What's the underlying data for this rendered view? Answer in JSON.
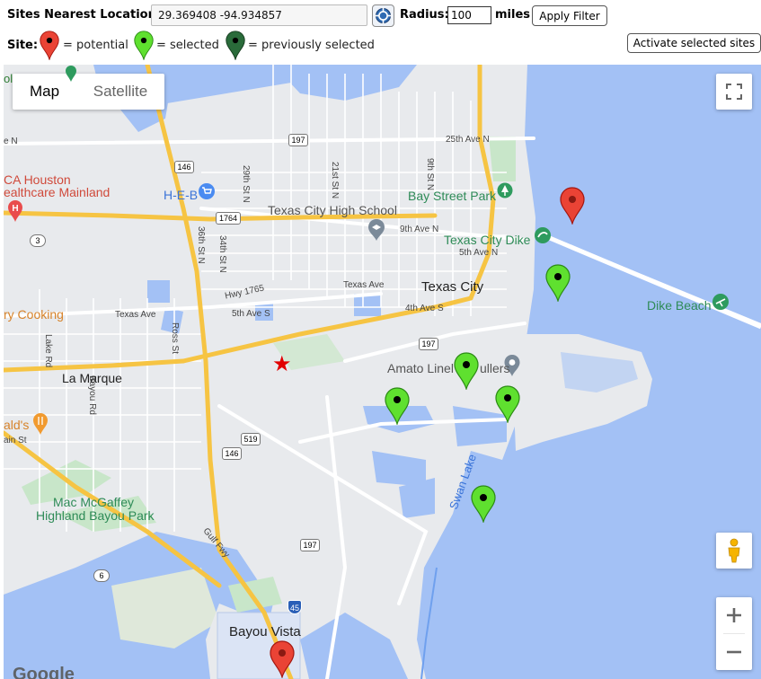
{
  "filter": {
    "location_label": "Sites Nearest Location:",
    "location_value": "29.369408 -94.934857",
    "radius_label": "Radius:",
    "radius_value": "100",
    "miles_label": "miles",
    "apply_label": "Apply Filter"
  },
  "legend": {
    "site_label": "Site:",
    "potential": "= potential",
    "selected": "= selected",
    "previously_selected": "= previously selected"
  },
  "activate_label": "Activate selected sites",
  "colors": {
    "potential": "#ea4335",
    "selected": "#5fe02f",
    "previously_selected": "#2a6b3a",
    "water": "#a3c1f5"
  },
  "map": {
    "type_map": "Map",
    "type_satellite": "Satellite",
    "labels": {
      "ol": "ol",
      "ave_n_left": "e N",
      "chca_1": "CA Houston",
      "chca_2": "ealthcare Mainland",
      "heb": "H-E-B",
      "tc_high": "Texas City High School",
      "bay_street": "Bay Street Park",
      "tc_dike": "Texas City Dike",
      "dike_beach": "Dike Beach",
      "ave_25": "25th Ave N",
      "ave_9": "9th Ave N",
      "ave_5n": "5th Ave N",
      "texas_city": "Texas City",
      "texas_ave": "Texas Ave",
      "ave_4s": "4th Ave S",
      "hwy_1765": "Hwy 1765",
      "ave_5s": "5th Ave S",
      "texas_ave_w": "Texas Ave",
      "st_29": "29th St N",
      "st_21": "21st St N",
      "st_9": "9th St N",
      "st_36": "36th St N",
      "st_34": "34th St N",
      "lake_rd": "Lake Rd",
      "ross_st": "Ross St",
      "bayou_rd": "Bayou Rd",
      "cooking": "ry Cooking",
      "la_marque": "La Marque",
      "amato": "Amato Linel",
      "ullers": "ullers",
      "alds": "ald's",
      "ain_st": "ain St",
      "mac_1": "Mac McGaffey",
      "mac_2": "Highland Bayou Park",
      "swan_lake": "Swan Lake",
      "gulf_fwy": "Gulf Fwy",
      "bayou_vista": "Bayou Vista",
      "google": "Google"
    },
    "shields": {
      "r197a": "197",
      "r146a": "146",
      "r1764": "1764",
      "r3": "3",
      "r197b": "197",
      "r519": "519",
      "r146b": "146",
      "r197c": "197",
      "r6": "6",
      "i45": "45"
    },
    "markers": [
      "potential",
      "selected",
      "selected",
      "selected",
      "selected",
      "selected",
      "potential"
    ]
  }
}
